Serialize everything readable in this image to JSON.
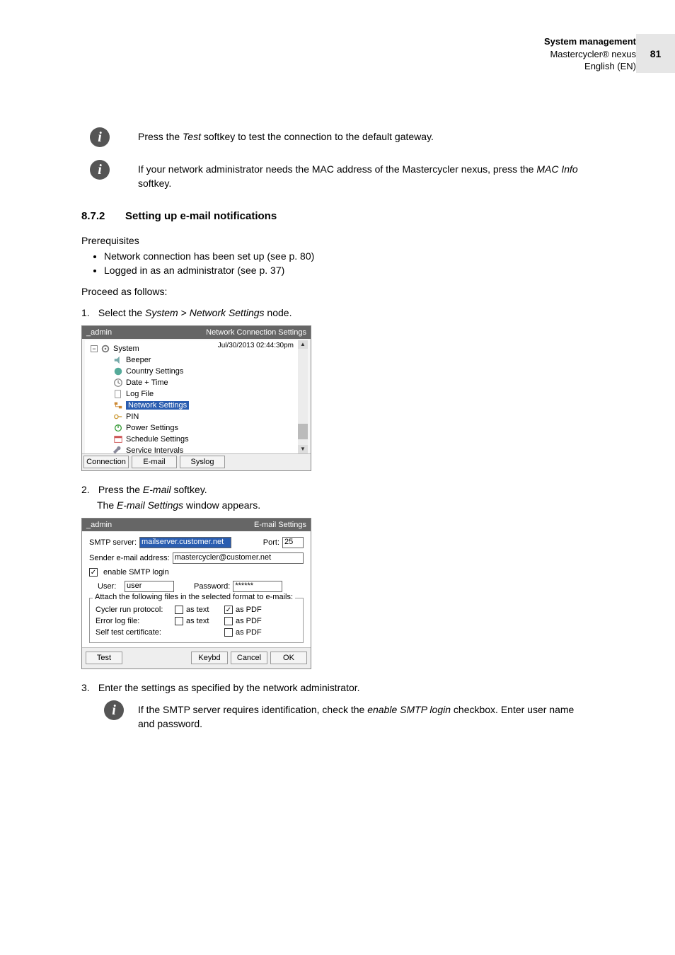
{
  "header": {
    "title": "System management",
    "subtitle": "Mastercycler® nexus",
    "lang": "English (EN)",
    "page_number": "81"
  },
  "info_notes": {
    "test_gateway_pre": "Press the ",
    "test_gateway_mid": "Test",
    "test_gateway_post": " softkey to test the connection to the default gateway.",
    "mac_pre": "If your network administrator needs the MAC address of the Mastercycler nexus, press the ",
    "mac_mid": "MAC Info",
    "mac_post": " softkey.",
    "smtp_pre": "If the SMTP server requires identification, check the ",
    "smtp_mid": "enable SMTP login",
    "smtp_post": " checkbox. Enter user name and password."
  },
  "section": {
    "number": "8.7.2",
    "title": "Setting up e-mail notifications",
    "prereq_label": "Prerequisites",
    "prereqs": [
      "Network connection has been set up (see p. 80)",
      "Logged in as an administrator (see p. 37)"
    ],
    "proceed": "Proceed as follows:"
  },
  "steps": {
    "s1_pre": "Select the ",
    "s1_mid1": "System",
    "s1_gt": " > ",
    "s1_mid2": "Network Settings",
    "s1_post": " node.",
    "s2_pre": "Press the ",
    "s2_mid": "E-mail",
    "s2_post": " softkey.",
    "s2_sub_pre": "The ",
    "s2_sub_mid": "E-mail Settings",
    "s2_sub_post": " window appears.",
    "s3": "Enter the settings as specified by the network administrator."
  },
  "screenshot1": {
    "title_left": "_admin",
    "title_right": "Network Connection Settings",
    "timestamp": "Jul/30/2013 02:44:30pm",
    "tree": {
      "root": "System",
      "items": [
        "Beeper",
        "Country Settings",
        "Date + Time",
        "Log File",
        "Network Settings",
        "PIN",
        "Power Settings",
        "Schedule Settings",
        "Service Intervals"
      ],
      "selected_index": 4
    },
    "buttons": [
      "Connection",
      "E-mail",
      "Syslog"
    ]
  },
  "screenshot2": {
    "title_left": "_admin",
    "title_right": "E-mail Settings",
    "fields": {
      "smtp_label": "SMTP server:",
      "smtp_value": "mailserver.customer.net",
      "port_label": "Port:",
      "port_value": "25",
      "sender_label": "Sender e-mail address:",
      "sender_value": "mastercycler@customer.net",
      "enable_smtp_label": "enable SMTP login",
      "user_label": "User:",
      "user_value": "user",
      "password_label": "Password:",
      "password_value": "******"
    },
    "attach": {
      "legend": "Attach the following files in the selected format to e-mails:",
      "rows": [
        {
          "label": "Cycler run protocol:",
          "as_text": true,
          "as_pdf": true,
          "text_unchecked": true,
          "pdf_checked": true
        },
        {
          "label": "Error log file:",
          "as_text": true,
          "as_pdf": true
        },
        {
          "label": "Self test certificate:",
          "as_text": false,
          "as_pdf": true
        }
      ],
      "as_text": "as text",
      "as_pdf": "as PDF"
    },
    "buttons": {
      "test": "Test",
      "keybd": "Keybd",
      "cancel": "Cancel",
      "ok": "OK"
    }
  }
}
